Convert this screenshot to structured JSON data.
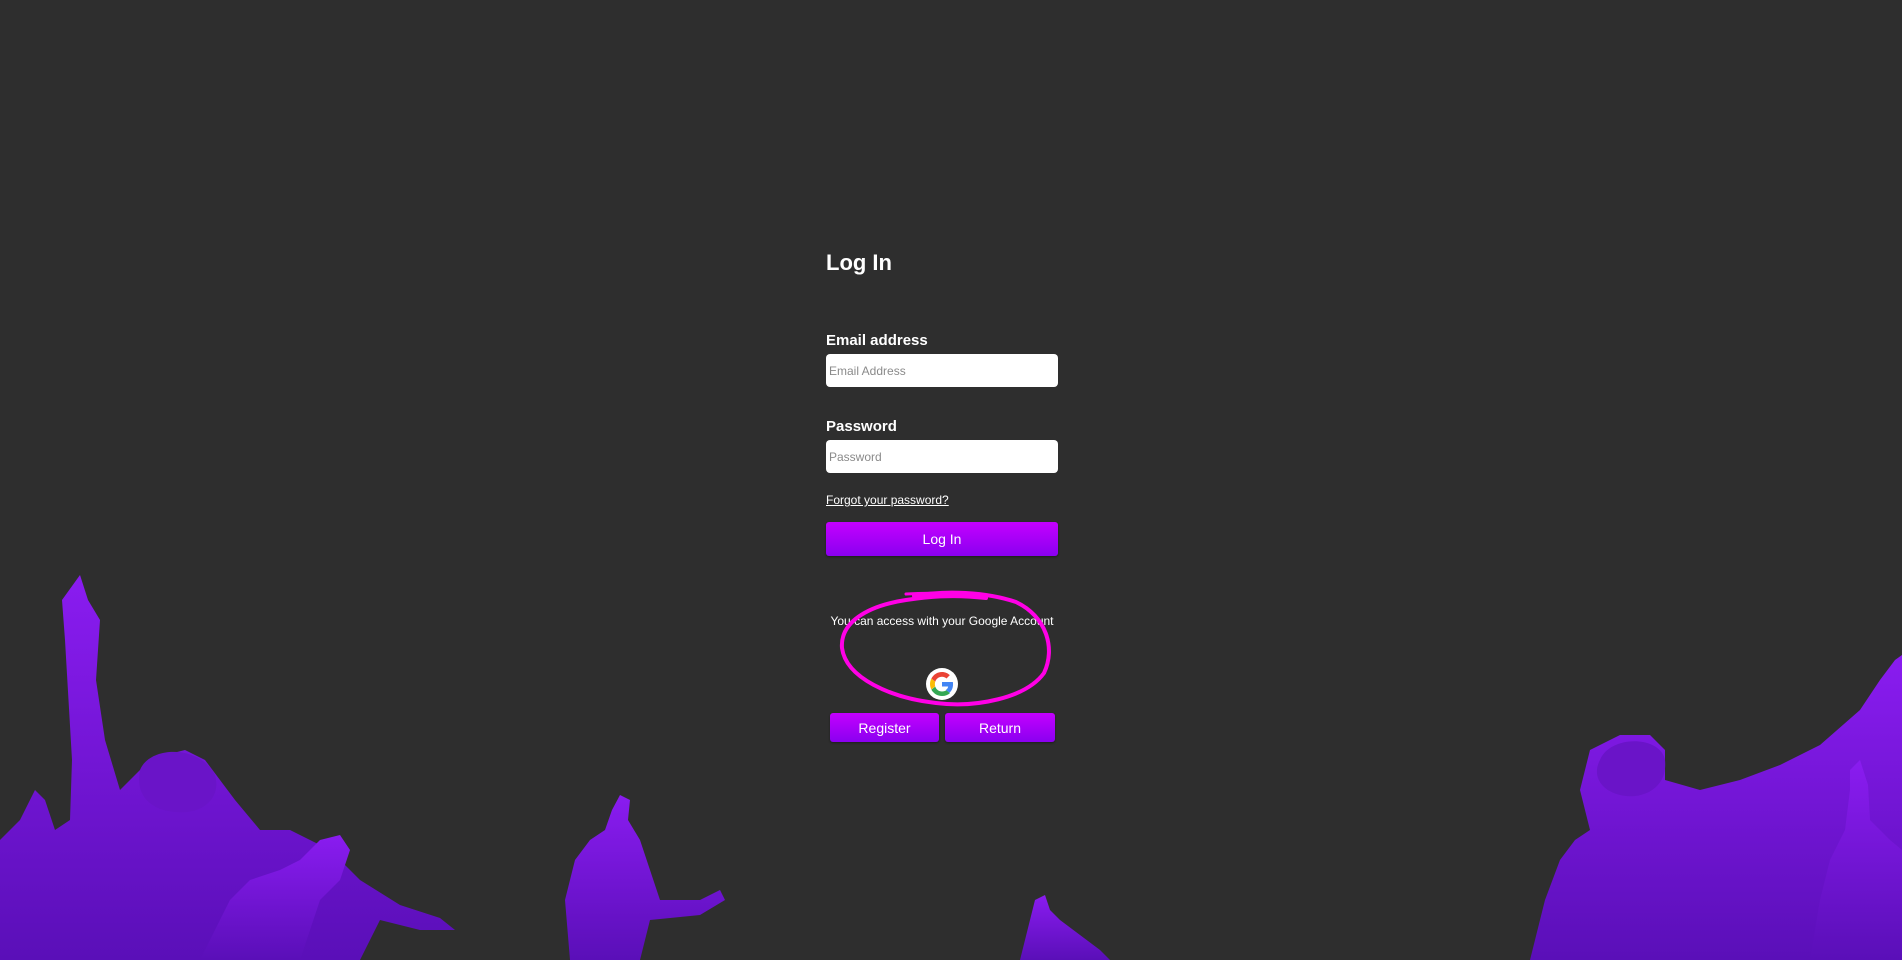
{
  "login": {
    "title": "Log In",
    "email_label": "Email address",
    "email_placeholder": "Email Address",
    "email_value": "",
    "password_label": "Password",
    "password_placeholder": "Password",
    "password_value": "",
    "forgot_link": "Forgot your password?",
    "submit_label": "Log In"
  },
  "google": {
    "text": "You can access with your Google Account",
    "icon": "google-icon"
  },
  "actions": {
    "register_label": "Register",
    "return_label": "Return"
  },
  "colors": {
    "background": "#2e2e2e",
    "accent": "#b000ff",
    "crowd": "#7a12e6",
    "annotation": "#ff00e6"
  }
}
